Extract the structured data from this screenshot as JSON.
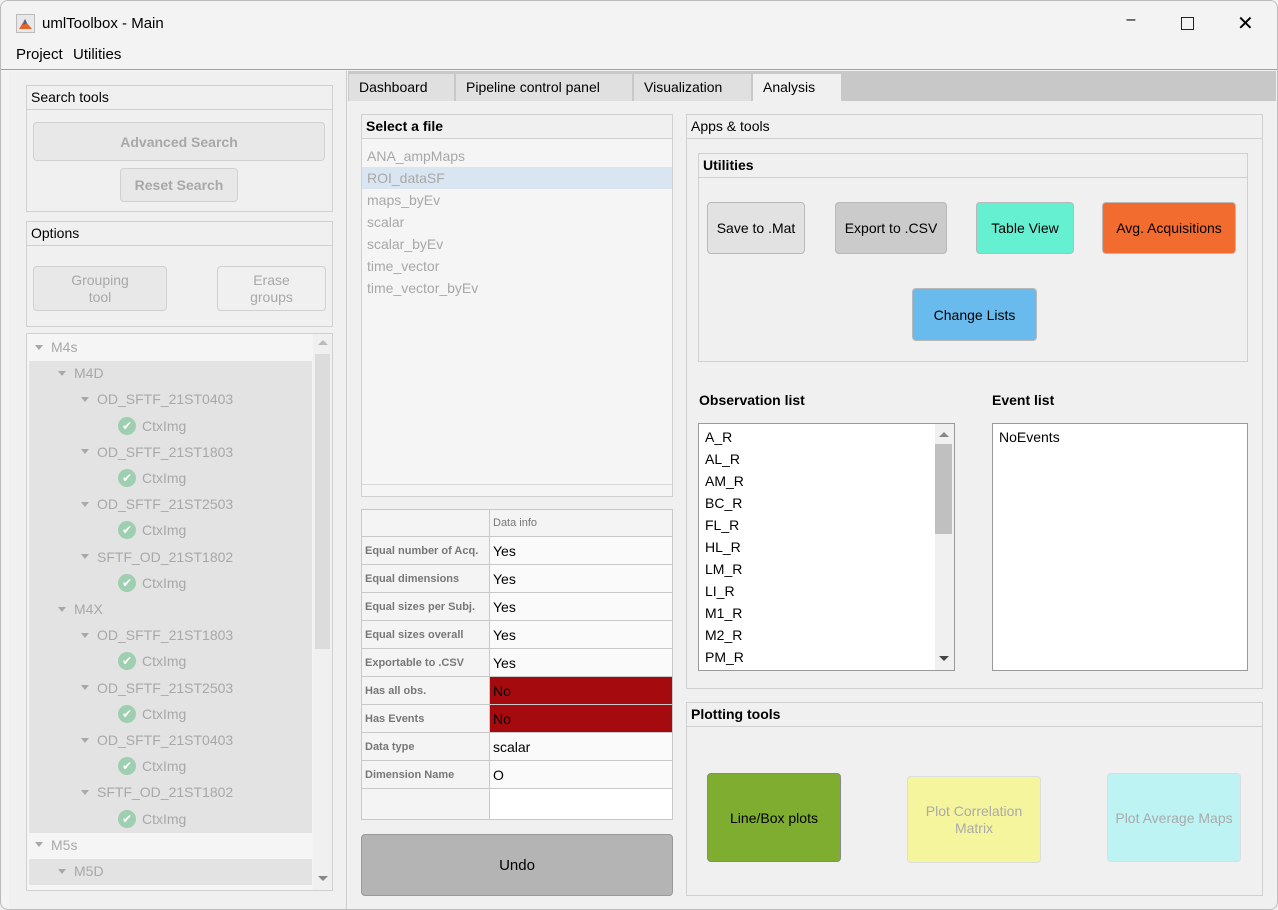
{
  "window": {
    "title": "umlToolbox - Main",
    "controls": [
      "minimize",
      "maximize",
      "close"
    ]
  },
  "menu": [
    "Project",
    "Utilities"
  ],
  "search_tools": {
    "title": "Search tools",
    "advanced_search": "Advanced Search",
    "reset_search": "Reset Search"
  },
  "options": {
    "title": "Options",
    "grouping_tool": "Grouping\ntool",
    "erase_groups": "Erase\ngroups"
  },
  "tree": [
    {
      "label": "M4s",
      "level": 0,
      "type": "node"
    },
    {
      "label": "M4D",
      "level": 1,
      "type": "node"
    },
    {
      "label": "OD_SFTF_21ST0403",
      "level": 2,
      "type": "node"
    },
    {
      "label": "CtxImg",
      "level": 3,
      "type": "leaf"
    },
    {
      "label": "OD_SFTF_21ST1803",
      "level": 2,
      "type": "node"
    },
    {
      "label": "CtxImg",
      "level": 3,
      "type": "leaf"
    },
    {
      "label": "OD_SFTF_21ST2503",
      "level": 2,
      "type": "node"
    },
    {
      "label": "CtxImg",
      "level": 3,
      "type": "leaf"
    },
    {
      "label": "SFTF_OD_21ST1802",
      "level": 2,
      "type": "node"
    },
    {
      "label": "CtxImg",
      "level": 3,
      "type": "leaf"
    },
    {
      "label": "M4X",
      "level": 1,
      "type": "node"
    },
    {
      "label": "OD_SFTF_21ST1803",
      "level": 2,
      "type": "node"
    },
    {
      "label": "CtxImg",
      "level": 3,
      "type": "leaf"
    },
    {
      "label": "OD_SFTF_21ST2503",
      "level": 2,
      "type": "node"
    },
    {
      "label": "CtxImg",
      "level": 3,
      "type": "leaf"
    },
    {
      "label": "OD_SFTF_21ST0403",
      "level": 2,
      "type": "node"
    },
    {
      "label": "CtxImg",
      "level": 3,
      "type": "leaf"
    },
    {
      "label": "SFTF_OD_21ST1802",
      "level": 2,
      "type": "node"
    },
    {
      "label": "CtxImg",
      "level": 3,
      "type": "leaf"
    },
    {
      "label": "M5s",
      "level": 0,
      "type": "node"
    },
    {
      "label": "M5D",
      "level": 1,
      "type": "node"
    }
  ],
  "tabs": [
    {
      "label": "Dashboard"
    },
    {
      "label": "Pipeline control panel"
    },
    {
      "label": "Visualization"
    },
    {
      "label": "Analysis",
      "active": true
    }
  ],
  "file_select": {
    "title": "Select a file",
    "items": [
      "ANA_ampMaps",
      "ROI_dataSF",
      "maps_byEv",
      "scalar",
      "scalar_byEv",
      "time_vector",
      "time_vector_byEv"
    ],
    "selected": "ROI_dataSF"
  },
  "data_info": {
    "header": "Data info",
    "rows": [
      {
        "label": "Equal number of Acq.",
        "value": "Yes",
        "status": "ok"
      },
      {
        "label": "Equal dimensions",
        "value": "Yes",
        "status": "ok"
      },
      {
        "label": "Equal sizes per Subj.",
        "value": "Yes",
        "status": "ok"
      },
      {
        "label": "Equal sizes overall",
        "value": "Yes",
        "status": "ok"
      },
      {
        "label": "Exportable to .CSV",
        "value": "Yes",
        "status": "ok"
      },
      {
        "label": "Has all obs.",
        "value": "No",
        "status": "bad"
      },
      {
        "label": "Has Events",
        "value": "No",
        "status": "bad"
      },
      {
        "label": "Data type",
        "value": "scalar",
        "status": "ok"
      },
      {
        "label": "Dimension Name",
        "value": "O",
        "status": "ok"
      }
    ],
    "bad_color": "#a50a0e"
  },
  "undo": "Undo",
  "apps": {
    "title": "Apps & tools",
    "utilities_title": "Utilities",
    "save_mat": "Save to .Mat",
    "export_csv": "Export to .CSV",
    "table_view": "Table View",
    "avg_acq": "Avg. Acquisitions",
    "change_lists": "Change Lists",
    "colors": {
      "table_view": "#66f0d2",
      "avg_acq": "#f26b2f",
      "change_lists": "#69bbee"
    }
  },
  "observation_list": {
    "title": "Observation list",
    "items": [
      "A_R",
      "AL_R",
      "AM_R",
      "BC_R",
      "FL_R",
      "HL_R",
      "LM_R",
      "LI_R",
      "M1_R",
      "M2_R",
      "PM_R"
    ]
  },
  "event_list": {
    "title": "Event list",
    "items": [
      "NoEvents"
    ]
  },
  "plotting": {
    "title": "Plotting tools",
    "line_box": "Line/Box plots",
    "corr_matrix": "Plot Correlation\nMatrix",
    "avg_maps": "Plot Average Maps",
    "colors": {
      "line_box": "#7ead30",
      "corr_matrix": "#f5f59d",
      "avg_maps": "#bdf3f3"
    }
  }
}
